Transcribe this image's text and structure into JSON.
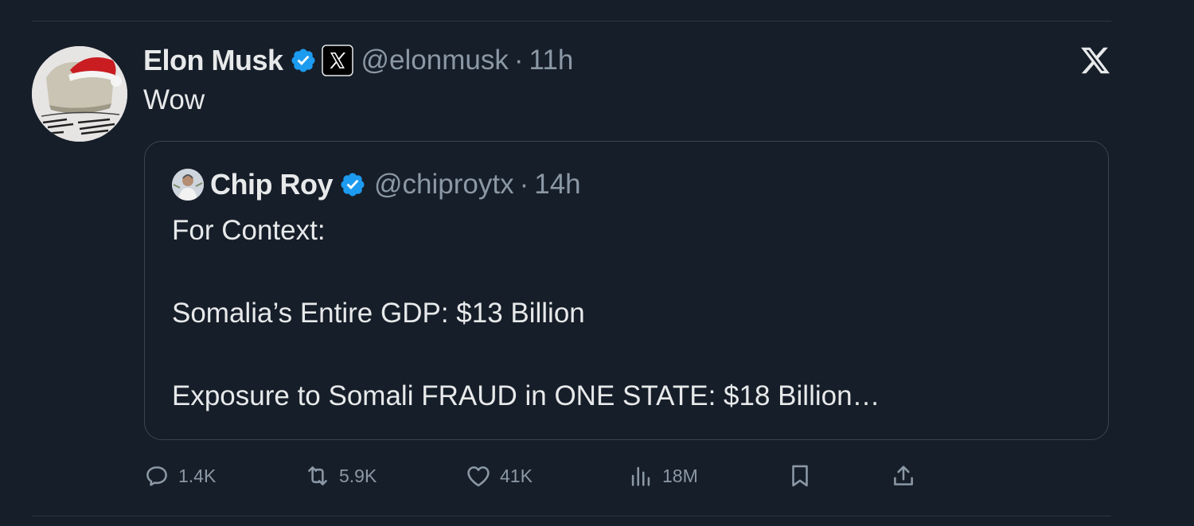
{
  "tweet": {
    "author_name": "Elon Musk",
    "handle": "@elonmusk",
    "separator": "·",
    "time": "11h",
    "text": "Wow",
    "avatar_icon": "avatar-santa-hat-icon",
    "verified_icon": "verified-badge-icon",
    "affiliation_icon": "x-affiliation-icon"
  },
  "quote": {
    "author_name": "Chip Roy",
    "handle": "@chiproytx",
    "separator": "·",
    "time": "14h",
    "lines": [
      "For Context:",
      "Somalia’s Entire GDP: $13 Billion",
      "Exposure to Somali FRAUD in ONE STATE: $18 Billion…"
    ]
  },
  "actions": {
    "replies": "1.4K",
    "reposts": "5.9K",
    "likes": "41K",
    "views": "18M",
    "bookmark_icon": "bookmark-icon",
    "share_icon": "share-icon"
  },
  "colors": {
    "background": "#161e29",
    "primary_text": "#e7e9ea",
    "secondary_text": "#8b98a5",
    "verified_blue": "#1d9bf0",
    "border": "#3a4450"
  }
}
